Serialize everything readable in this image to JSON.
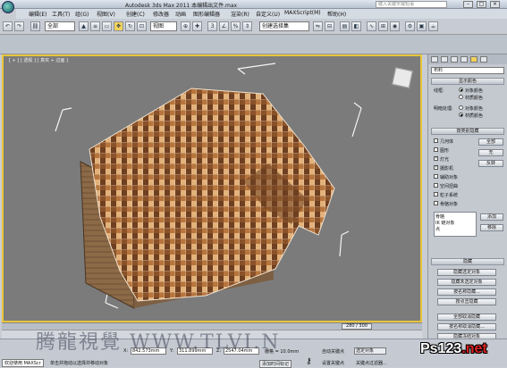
{
  "app": {
    "title": "Autodesk 3ds Max   2011     本编辑出文件.max",
    "search_placeholder": "键入关键字或短语"
  },
  "menu": [
    "编辑(E)",
    "工具(T)",
    "组(G)",
    "视图(V)",
    "创建(C)",
    "修改器",
    "动画",
    "图形编辑器",
    "渲染(R)",
    "自定义(U)",
    "MAXScript(M)",
    "帮助(H)"
  ],
  "toolbar": {
    "selection_filter": "全部",
    "ref_coord": "视图",
    "named_selection": "创建选择集"
  },
  "viewport": {
    "label": "[ + ] [ 透视 ] [ 真实 + 边面 ]",
    "accent": "#e8c63a"
  },
  "cmdpanel": {
    "object_type": "布料",
    "display_color_header": "显示颜色",
    "wireframe_label": "线框:",
    "shaded_label": "明暗处理:",
    "obj_color": "对象颜色",
    "mat_color": "材质颜色",
    "hide_by_category_header": "按类别隐藏",
    "categories": [
      {
        "label": "几何体",
        "checked": false
      },
      {
        "label": "图形",
        "checked": false
      },
      {
        "label": "灯光",
        "checked": true
      },
      {
        "label": "摄影机",
        "checked": true
      },
      {
        "label": "辅助对象",
        "checked": false
      },
      {
        "label": "空间扭曲",
        "checked": false
      },
      {
        "label": "粒子系统",
        "checked": false
      },
      {
        "label": "骨骼对象",
        "checked": false
      }
    ],
    "btn_all": "全部",
    "btn_none": "无",
    "btn_invert": "反转",
    "list_items": [
      "骨骼",
      "IK 链对象",
      "点"
    ],
    "btn_add": "添加",
    "btn_remove": "移除",
    "hide_header": "隐藏",
    "hide_buttons": [
      "隐藏选定对象",
      "隐藏未选定对象",
      "按名称隐藏...",
      "按点击隐藏",
      "全部取消隐藏",
      "按名称取消隐藏...",
      "隐藏冻结对象"
    ]
  },
  "timeline": {
    "frame": "280 / 300"
  },
  "status": {
    "x_label": "X:",
    "x_value": "842.573mm",
    "y_label": "Y:",
    "y_value": "311.899mm",
    "z_label": "Z:",
    "z_value": "2547.04mm",
    "grid": "栅格 = 10.0mm",
    "auto_key": "自动关键点",
    "selected": "选定对象",
    "set_key": "设置关键点",
    "key_filters": "关键点过滤器...",
    "welcome": "欢迎使用 MAXScr",
    "prompt": "单击并拖动以选择并移动对象",
    "add_time_tag": "添加时间标记"
  },
  "watermark": {
    "left": "腾龍視覺 WWW.TLVI.N",
    "right_main": "Ps123",
    "right_tld": ".net"
  }
}
